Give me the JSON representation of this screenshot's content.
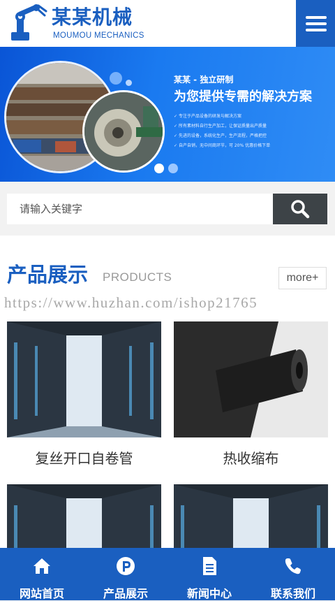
{
  "header": {
    "logo_title": "某某机械",
    "logo_subtitle": "MOUMOU MECHANICS",
    "menu_icon": "hamburger-menu-icon"
  },
  "banner": {
    "brand": "某某 - 独立研制",
    "headline": "为您提供专需的解决方案",
    "bullets": [
      "专注于产品设备的研发与解决方案",
      "所有素材料自行生产加工，让保证质量出产质量",
      "先进的设备，系统化生产，生产流程，严格把控",
      "自产自销，无中间商环节，可 20% 优惠价格下单"
    ],
    "active_slide": 1,
    "slide_count": 2
  },
  "search": {
    "placeholder": "请输入关键字",
    "button_icon": "search-icon"
  },
  "products_section": {
    "title": "产品展示",
    "subtitle": "PRODUCTS",
    "more_label": "more+",
    "watermark": "https://www.huzhan.com/ishop21765",
    "items": [
      {
        "name": "复丝开口自卷管"
      },
      {
        "name": "热收缩布"
      },
      {
        "name": ""
      },
      {
        "name": ""
      }
    ]
  },
  "bottom_nav": [
    {
      "label": "网站首页",
      "icon": "home-icon"
    },
    {
      "label": "产品展示",
      "icon": "products-p-icon"
    },
    {
      "label": "新闻中心",
      "icon": "document-icon"
    },
    {
      "label": "联系我们",
      "icon": "phone-icon"
    }
  ],
  "colors": {
    "brand_blue": "#1a5fc0",
    "search_button": "#3d4347",
    "banner_blue": "#1a7af0"
  }
}
